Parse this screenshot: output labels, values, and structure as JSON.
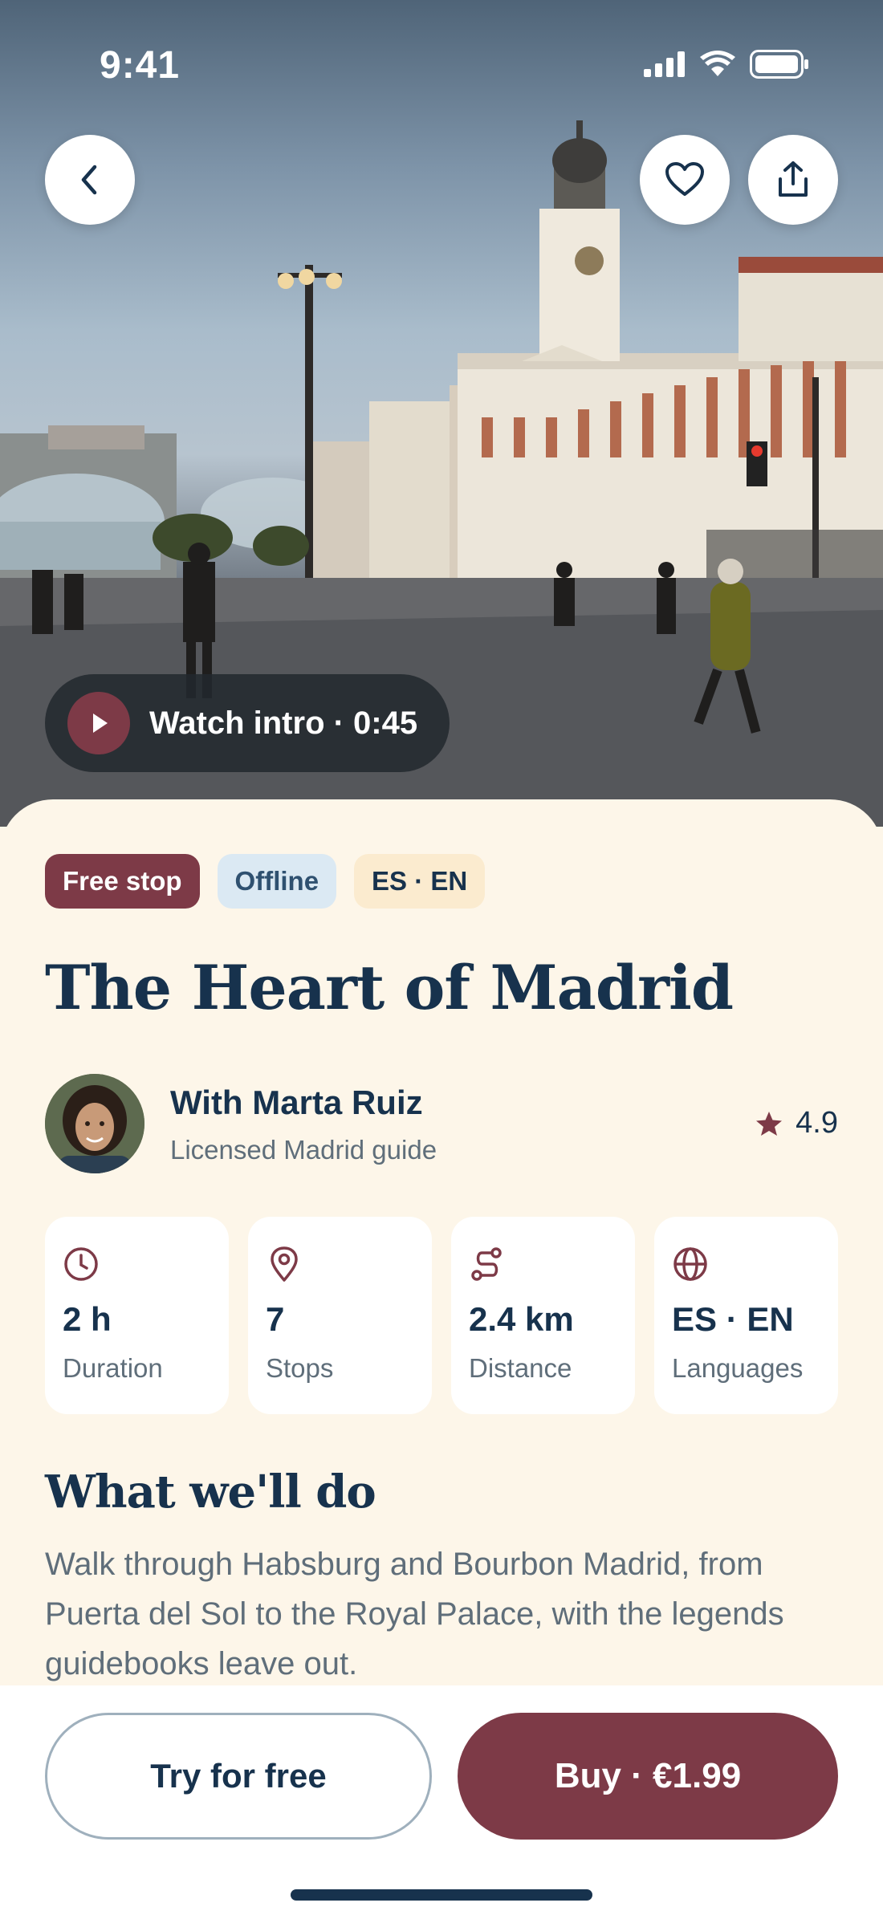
{
  "status_bar": {
    "time": "9:41"
  },
  "hero": {
    "watch_label": "Watch intro · 0:45"
  },
  "chips": {
    "free": "Free stop",
    "offline": "Offline",
    "languages": "ES · EN"
  },
  "tour": {
    "title": "The Heart of Madrid"
  },
  "guide": {
    "name": "With Marta Ruiz",
    "role": "Licensed Madrid guide",
    "rating": "4.9"
  },
  "stats": [
    {
      "icon": "clock-icon",
      "value": "2 h",
      "label": "Duration"
    },
    {
      "icon": "location-pin-icon",
      "value": "7",
      "label": "Stops"
    },
    {
      "icon": "route-icon",
      "value": "2.4 km",
      "label": "Distance"
    },
    {
      "icon": "globe-icon",
      "value": "ES · EN",
      "label": "Languages"
    }
  ],
  "about": {
    "heading": "What we'll do",
    "description": "Walk through Habsburg and Bourbon Madrid, from Puerta del Sol to the Royal Palace, with the legends guidebooks leave out."
  },
  "actions": {
    "try_label": "Try for free",
    "buy_label": "Buy · €1.99"
  },
  "colors": {
    "accent": "#7d3a47",
    "ink": "#17324d",
    "sheet_bg": "#fdf6e9",
    "offline_chip": "#dbe9f3",
    "lang_chip": "#fbebcf"
  }
}
